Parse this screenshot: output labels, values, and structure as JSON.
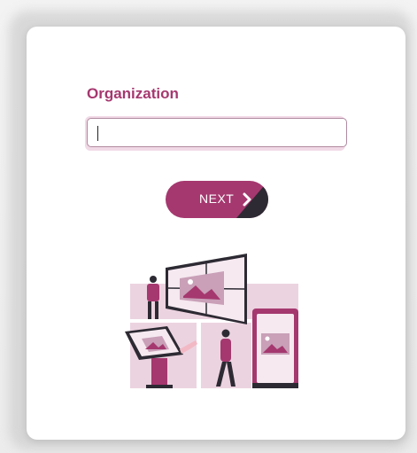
{
  "colors": {
    "accent": "#a5386f",
    "accent_light": "#ecd3e0",
    "dark": "#2d2a33"
  },
  "form": {
    "organization_label": "Organization",
    "organization_value": "",
    "organization_placeholder": ""
  },
  "actions": {
    "next_label": "NEXT",
    "next_icon": "chevron-right-icon"
  },
  "illustration": {
    "name": "digital-signage-illustration"
  }
}
